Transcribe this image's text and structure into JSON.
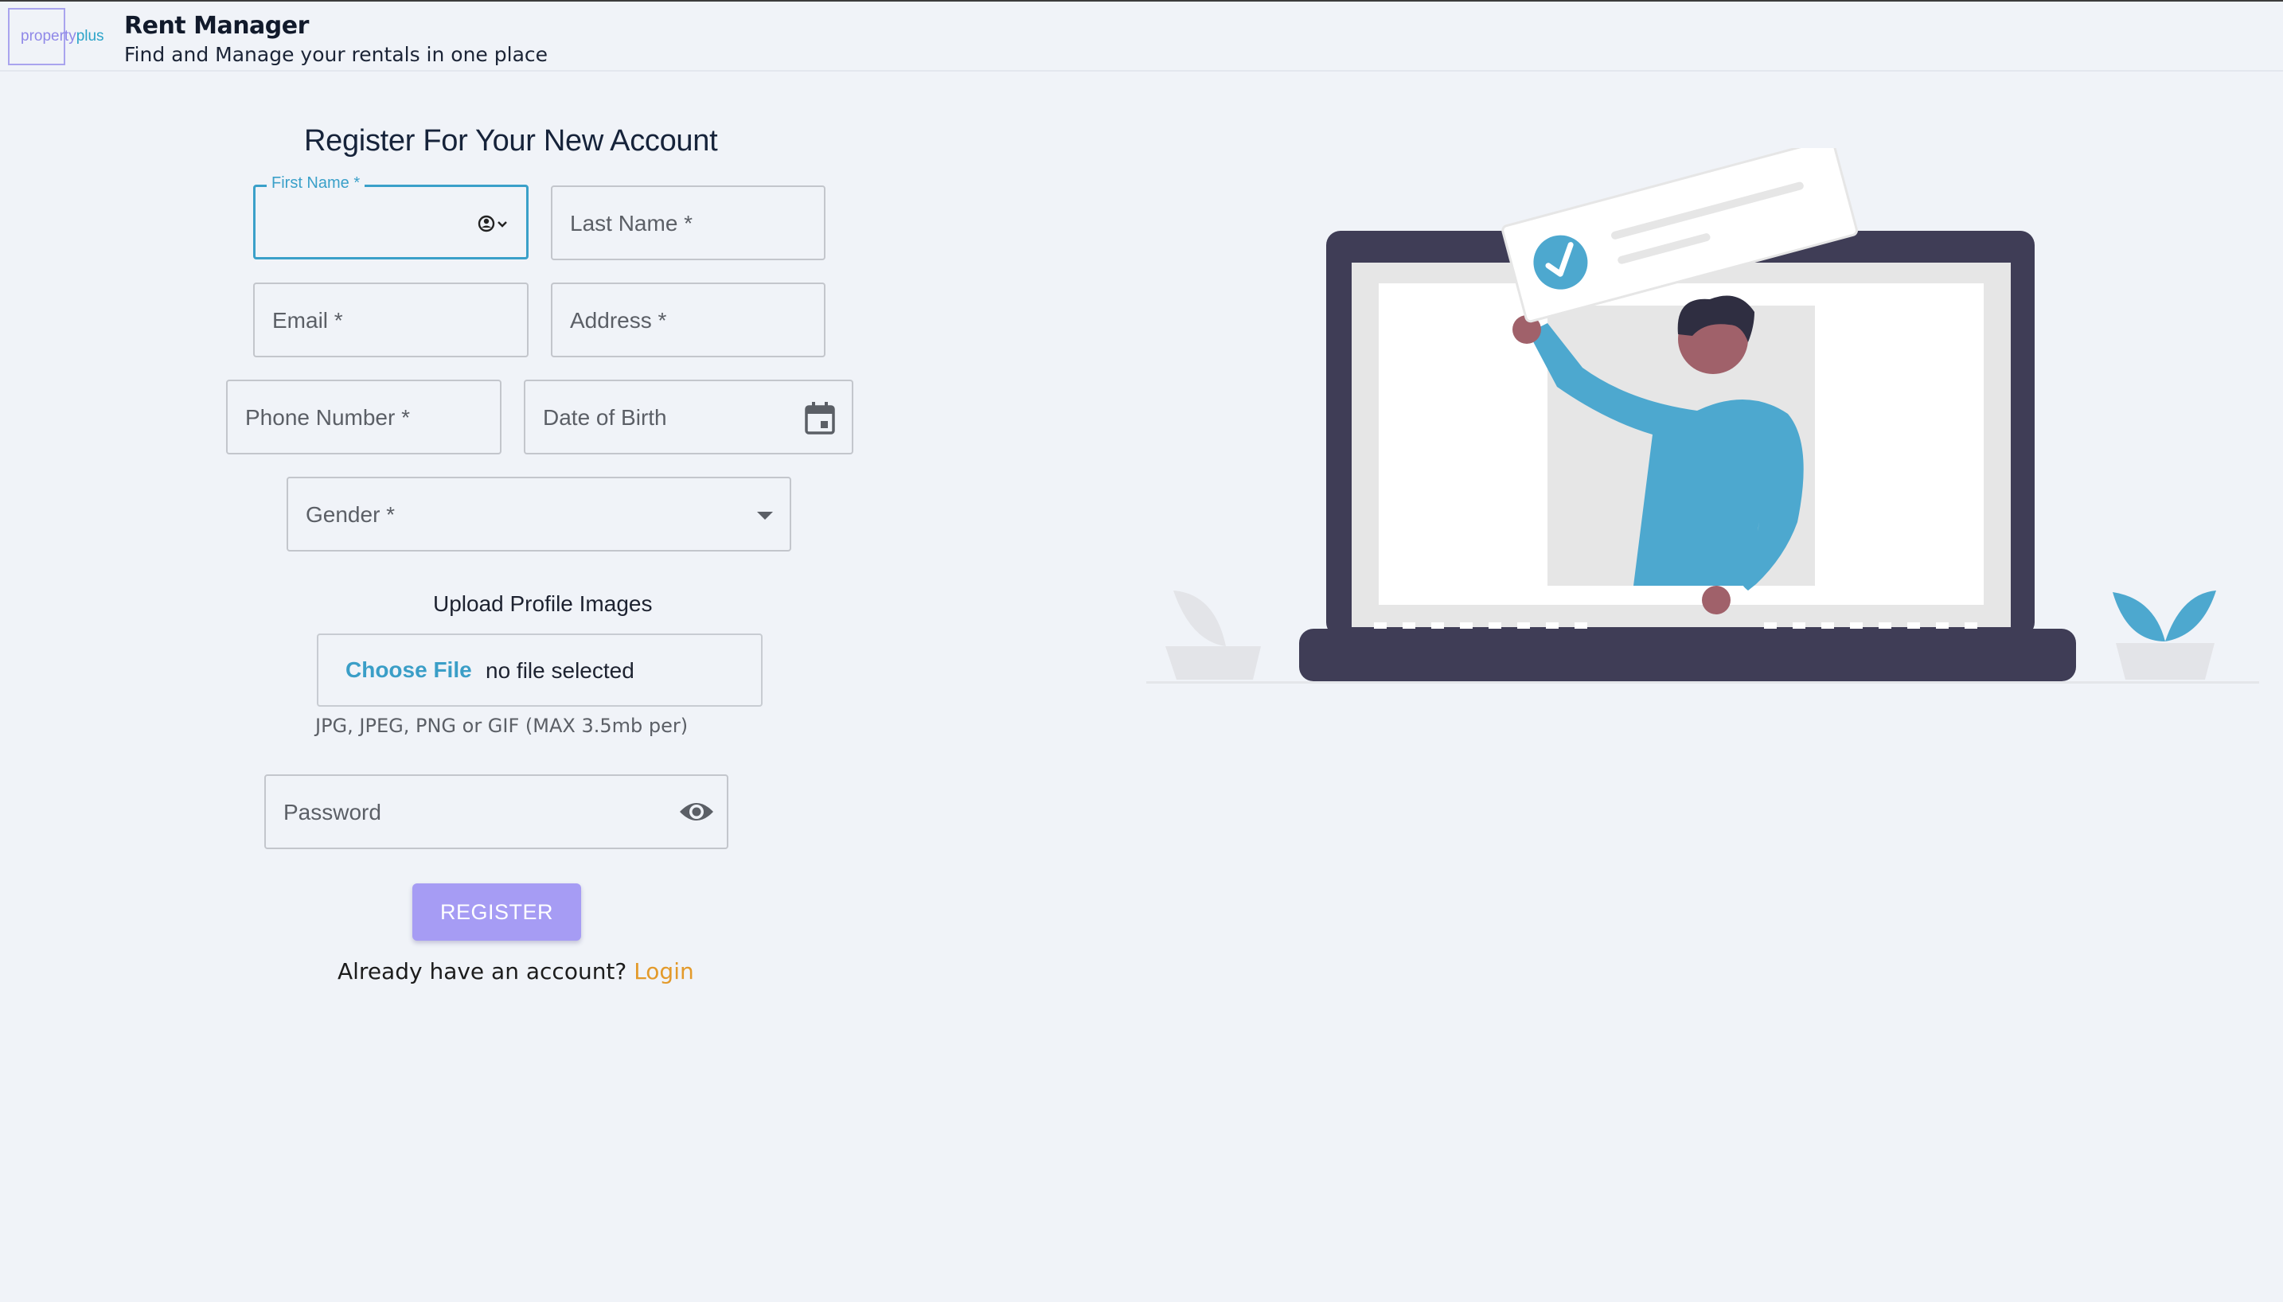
{
  "header": {
    "logo_text_main": "property",
    "logo_text_accent": "plus",
    "title": "Rent Manager",
    "subtitle": "Find and Manage your rentals in one place"
  },
  "form": {
    "title": "Register For Your New Account",
    "first_name_label": "First Name *",
    "last_name_label": "Last Name *",
    "email_label": "Email *",
    "address_label": "Address *",
    "phone_label": "Phone Number *",
    "dob_label": "Date of Birth",
    "gender_label": "Gender *",
    "upload_title": "Upload Profile Images",
    "choose_file_label": "Choose File",
    "file_status": "no file selected",
    "file_hint": "JPG, JPEG, PNG or GIF (MAX 3.5mb per)",
    "password_label": "Password",
    "register_label": "REGISTER",
    "login_prompt": "Already have an account?",
    "login_link": "Login"
  },
  "colors": {
    "accent_focus": "#3aa0c9",
    "button": "#a69cf4",
    "link": "#e39a2a",
    "illustration_primary": "#4da8cf",
    "illustration_dark": "#3f3d56"
  },
  "icons": [
    "contact-autofill-icon",
    "calendar-icon",
    "dropdown-arrow-icon",
    "eye-icon",
    "check-circle-icon"
  ]
}
